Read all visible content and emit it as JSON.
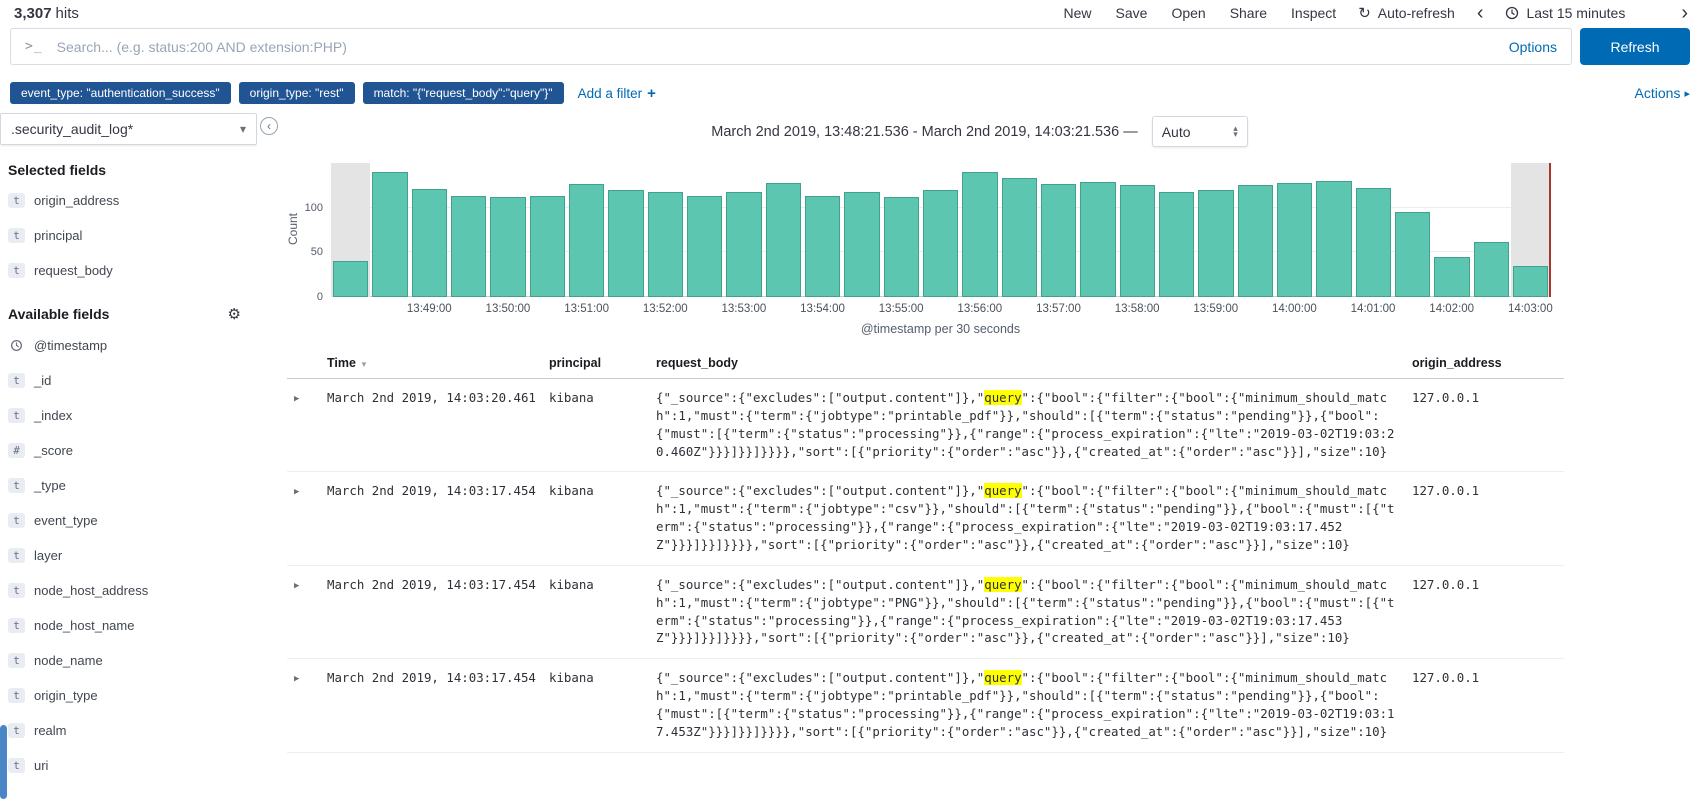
{
  "colors": {
    "accent": "#006BB4",
    "pill": "#205493",
    "bar": "#5cc6b0",
    "bar_border": "#41a18c",
    "highlight": "#ffff00",
    "partial_shade": "#e4e4e4",
    "range_end_line": "#a8362d"
  },
  "topbar": {
    "hits_number": "3,307",
    "hits_label": "hits",
    "menu": [
      "New",
      "Save",
      "Open",
      "Share",
      "Inspect"
    ],
    "auto_refresh_label": "Auto-refresh",
    "time_range_label": "Last 15 minutes"
  },
  "search": {
    "prompt_icon": ">_",
    "placeholder": "Search... (e.g. status:200 AND extension:PHP)",
    "options_label": "Options",
    "refresh_label": "Refresh"
  },
  "filters": {
    "pills": [
      "event_type: \"authentication_success\"",
      "origin_type: \"rest\"",
      "match: \"{\"request_body\":\"query\"}\""
    ],
    "add_filter_label": "Add a filter",
    "add_filter_plus": "+",
    "actions_label": "Actions"
  },
  "sidebar": {
    "index_pattern": ".security_audit_log*",
    "selected_fields_header": "Selected fields",
    "selected_fields": [
      {
        "type": "t",
        "name": "origin_address"
      },
      {
        "type": "t",
        "name": "principal"
      },
      {
        "type": "t",
        "name": "request_body"
      }
    ],
    "available_fields_header": "Available fields",
    "available_fields": [
      {
        "type": "clock",
        "name": "@timestamp"
      },
      {
        "type": "t",
        "name": "_id"
      },
      {
        "type": "t",
        "name": "_index"
      },
      {
        "type": "#",
        "name": "_score"
      },
      {
        "type": "t",
        "name": "_type"
      },
      {
        "type": "t",
        "name": "event_type"
      },
      {
        "type": "t",
        "name": "layer"
      },
      {
        "type": "t",
        "name": "node_host_address"
      },
      {
        "type": "t",
        "name": "node_host_name"
      },
      {
        "type": "t",
        "name": "node_name"
      },
      {
        "type": "t",
        "name": "origin_type"
      },
      {
        "type": "t",
        "name": "realm"
      },
      {
        "type": "t",
        "name": "uri"
      }
    ]
  },
  "chart_header": {
    "range_text": "March 2nd 2019, 13:48:21.536 - March 2nd 2019, 14:03:21.536 —",
    "interval_value": "Auto"
  },
  "chart_data": {
    "type": "bar",
    "title": "",
    "ylabel": "Count",
    "xlabel": "@timestamp per 30 seconds",
    "ylim": [
      0,
      150
    ],
    "yticks": [
      0,
      50,
      100
    ],
    "grid": true,
    "legend": false,
    "categories": [
      "13:48:00",
      "13:48:30",
      "13:49:00",
      "13:49:30",
      "13:50:00",
      "13:50:30",
      "13:51:00",
      "13:51:30",
      "13:52:00",
      "13:52:30",
      "13:53:00",
      "13:53:30",
      "13:54:00",
      "13:54:30",
      "13:55:00",
      "13:55:30",
      "13:56:00",
      "13:56:30",
      "13:57:00",
      "13:57:30",
      "13:58:00",
      "13:58:30",
      "13:59:00",
      "13:59:30",
      "14:00:00",
      "14:00:30",
      "14:01:00",
      "14:01:30",
      "14:02:00",
      "14:02:30",
      "14:03:00"
    ],
    "values": [
      40,
      140,
      121,
      113,
      112,
      113,
      127,
      120,
      118,
      113,
      117,
      128,
      113,
      117,
      112,
      120,
      140,
      133,
      126,
      129,
      125,
      117,
      120,
      125,
      128,
      130,
      122,
      95,
      45,
      62,
      35
    ],
    "x_tick_labels": [
      "13:49:00",
      "13:50:00",
      "13:51:00",
      "13:52:00",
      "13:53:00",
      "13:54:00",
      "13:55:00",
      "13:56:00",
      "13:57:00",
      "13:58:00",
      "13:59:00",
      "14:00:00",
      "14:01:00",
      "14:02:00",
      "14:03:00"
    ],
    "partial_indices": [
      0,
      30
    ]
  },
  "table": {
    "columns": [
      "Time",
      "principal",
      "request_body",
      "origin_address"
    ],
    "highlight": "query",
    "rows": [
      {
        "time": "March 2nd 2019, 14:03:20.461",
        "principal": "kibana",
        "request_body": "{\"_source\":{\"excludes\":[\"output.content\"]},\"query\":{\"bool\":{\"filter\":{\"bool\":{\"minimum_should_match\":1,\"must\":{\"term\":{\"jobtype\":\"printable_pdf\"}},\"should\":[{\"term\":{\"status\":\"pending\"}},{\"bool\":{\"must\":[{\"term\":{\"status\":\"processing\"}},{\"range\":{\"process_expiration\":{\"lte\":\"2019-03-02T19:03:20.460Z\"}}}]}}]}}}},\"sort\":[{\"priority\":{\"order\":\"asc\"}},{\"created_at\":{\"order\":\"asc\"}}],\"size\":10}",
        "origin_address": "127.0.0.1"
      },
      {
        "time": "March 2nd 2019, 14:03:17.454",
        "principal": "kibana",
        "request_body": "{\"_source\":{\"excludes\":[\"output.content\"]},\"query\":{\"bool\":{\"filter\":{\"bool\":{\"minimum_should_match\":1,\"must\":{\"term\":{\"jobtype\":\"csv\"}},\"should\":[{\"term\":{\"status\":\"pending\"}},{\"bool\":{\"must\":[{\"term\":{\"status\":\"processing\"}},{\"range\":{\"process_expiration\":{\"lte\":\"2019-03-02T19:03:17.452Z\"}}}]}}]}}}},\"sort\":[{\"priority\":{\"order\":\"asc\"}},{\"created_at\":{\"order\":\"asc\"}}],\"size\":10}",
        "origin_address": "127.0.0.1"
      },
      {
        "time": "March 2nd 2019, 14:03:17.454",
        "principal": "kibana",
        "request_body": "{\"_source\":{\"excludes\":[\"output.content\"]},\"query\":{\"bool\":{\"filter\":{\"bool\":{\"minimum_should_match\":1,\"must\":{\"term\":{\"jobtype\":\"PNG\"}},\"should\":[{\"term\":{\"status\":\"pending\"}},{\"bool\":{\"must\":[{\"term\":{\"status\":\"processing\"}},{\"range\":{\"process_expiration\":{\"lte\":\"2019-03-02T19:03:17.453Z\"}}}]}}]}}}},\"sort\":[{\"priority\":{\"order\":\"asc\"}},{\"created_at\":{\"order\":\"asc\"}}],\"size\":10}",
        "origin_address": "127.0.0.1"
      },
      {
        "time": "March 2nd 2019, 14:03:17.454",
        "principal": "kibana",
        "request_body": "{\"_source\":{\"excludes\":[\"output.content\"]},\"query\":{\"bool\":{\"filter\":{\"bool\":{\"minimum_should_match\":1,\"must\":{\"term\":{\"jobtype\":\"printable_pdf\"}},\"should\":[{\"term\":{\"status\":\"pending\"}},{\"bool\":{\"must\":[{\"term\":{\"status\":\"processing\"}},{\"range\":{\"process_expiration\":{\"lte\":\"2019-03-02T19:03:17.453Z\"}}}]}}]}}}},\"sort\":[{\"priority\":{\"order\":\"asc\"}},{\"created_at\":{\"order\":\"asc\"}}],\"size\":10}",
        "origin_address": "127.0.0.1"
      }
    ]
  }
}
